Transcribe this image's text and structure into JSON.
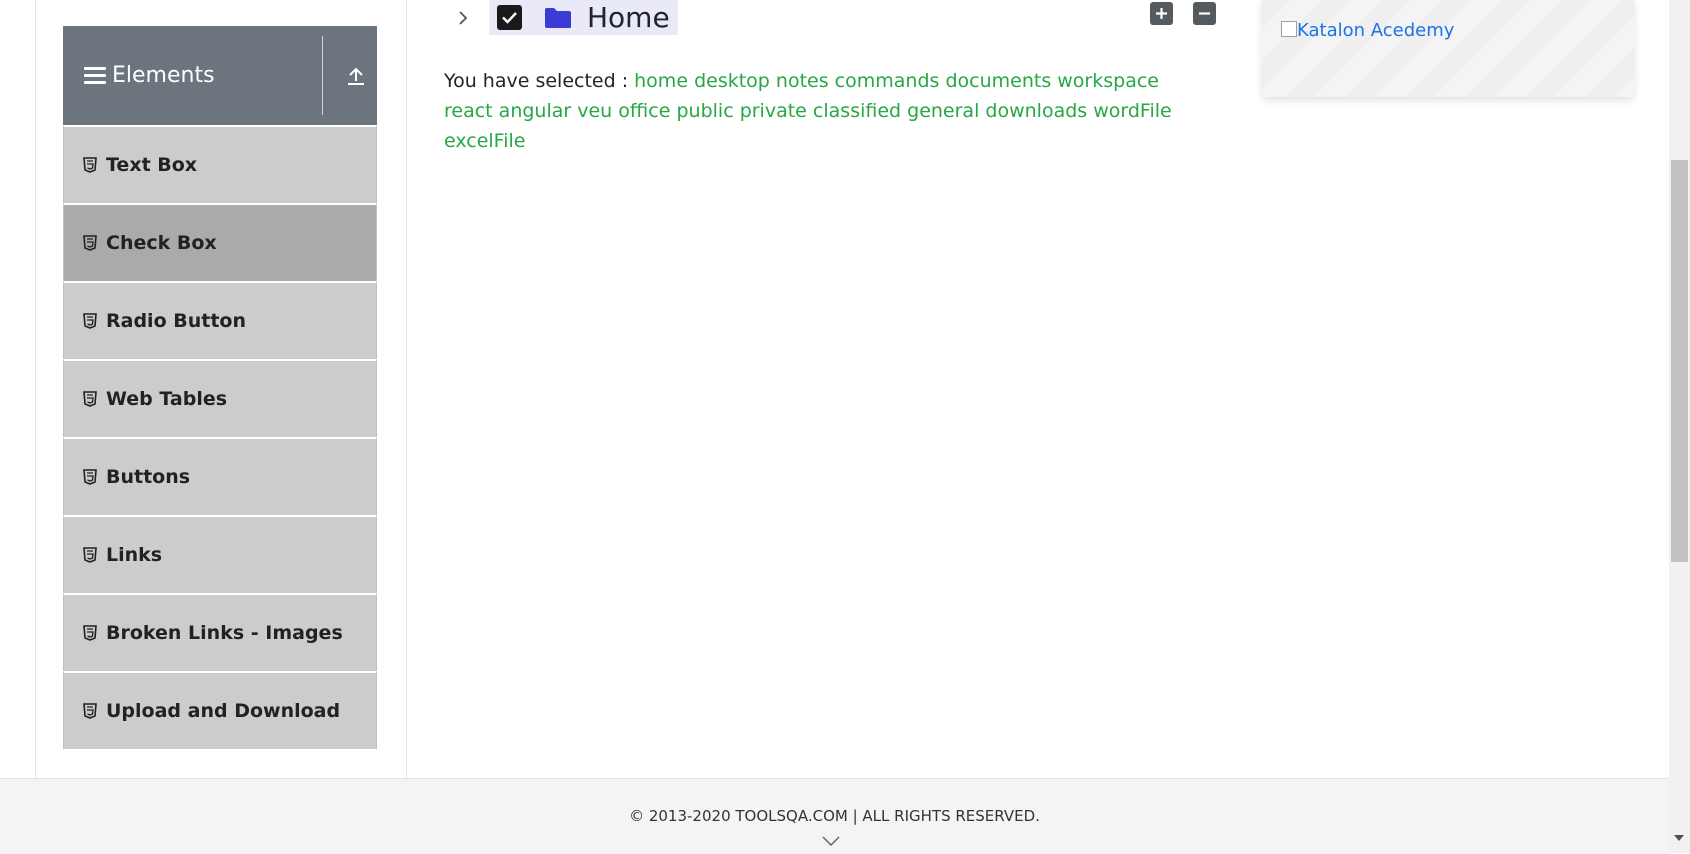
{
  "sidebar": {
    "group_title": "Elements",
    "items": [
      {
        "label": "Text Box",
        "active": false
      },
      {
        "label": "Check Box",
        "active": true
      },
      {
        "label": "Radio Button",
        "active": false
      },
      {
        "label": "Web Tables",
        "active": false
      },
      {
        "label": "Buttons",
        "active": false
      },
      {
        "label": "Links",
        "active": false
      },
      {
        "label": "Broken Links - Images",
        "active": false
      },
      {
        "label": "Upload and Download",
        "active": false
      }
    ]
  },
  "tree": {
    "node_label": "Home",
    "checked": true,
    "expand_all_icon": "plus-square-icon",
    "collapse_all_icon": "minus-square-icon"
  },
  "result": {
    "prefix": "You have selected :",
    "items": [
      "home",
      "desktop",
      "notes",
      "commands",
      "documents",
      "workspace",
      "react",
      "angular",
      "veu",
      "office",
      "public",
      "private",
      "classified",
      "general",
      "downloads",
      "wordFile",
      "excelFile"
    ]
  },
  "ad": {
    "alt_text": "Katalon Acedemy"
  },
  "footer": {
    "copyright": "© 2013-2020 TOOLSQA.COM | ALL RIGHTS RESERVED."
  },
  "colors": {
    "sidebar_header": "#6c757d",
    "menu_item": "#cccccc",
    "menu_item_active": "#aaaaaa",
    "result_item": "#28a745",
    "folder": "#3b3bd6",
    "link": "#1a73e8"
  }
}
